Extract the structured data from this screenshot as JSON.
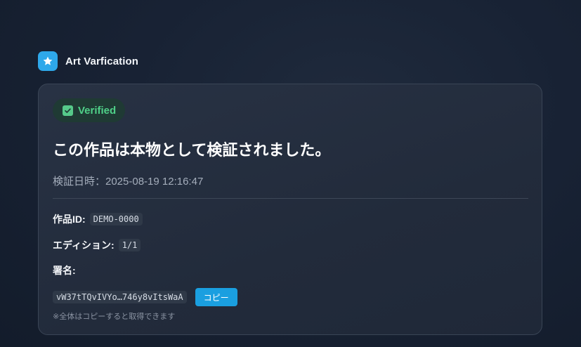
{
  "app": {
    "title": "Art Varfication",
    "logo_icon": "star-icon",
    "accent": "#2ea8ea"
  },
  "badge": {
    "label": "Verified",
    "icon": "check-square-icon",
    "color": "#4fd088"
  },
  "card": {
    "headline": "この作品は本物として検証されました。",
    "date_text": "検証日時：2025-08-19 12:16:47",
    "fields": {
      "work_id": {
        "label": "作品ID:",
        "value": "DEMO-0000"
      },
      "edition": {
        "label": "エディション:",
        "value": "1/1"
      },
      "signature": {
        "label": "署名:",
        "value": "vW37tTQvIVYo…746y8vItsWaA"
      }
    },
    "copy_button_label": "コピー",
    "copy_hint": "※全体はコピーすると取得できます"
  }
}
